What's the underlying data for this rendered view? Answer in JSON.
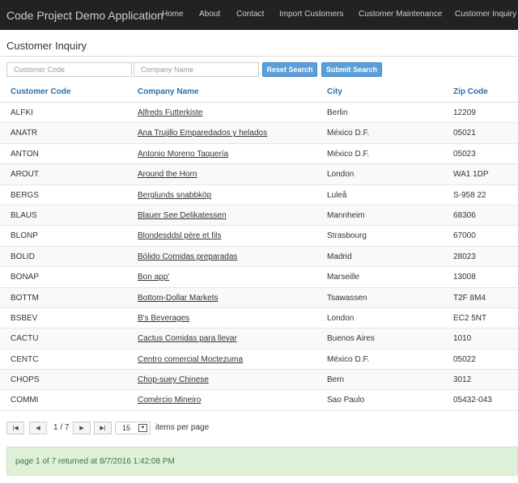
{
  "navbar": {
    "brand": "Code Project Demo Application",
    "links": [
      "Home",
      "About",
      "Contact",
      "Import Customers",
      "Customer Maintenance",
      "Customer Inquiry"
    ]
  },
  "page": {
    "title": "Customer Inquiry"
  },
  "search": {
    "customer_code_placeholder": "Customer Code",
    "company_name_placeholder": "Company Name",
    "reset_label": "Reset Search",
    "submit_label": "Submit Search"
  },
  "table": {
    "headers": [
      "Customer Code",
      "Company Name",
      "City",
      "Zip Code"
    ],
    "rows": [
      [
        "ALFKI",
        "Alfreds Futterkiste",
        "Berlin",
        "12209"
      ],
      [
        "ANATR",
        "Ana Trujillo Emparedados y helados",
        "México D.F.",
        "05021"
      ],
      [
        "ANTON",
        "Antonio Moreno Taquería",
        "México D.F.",
        "05023"
      ],
      [
        "AROUT",
        "Around the Horn",
        "London",
        "WA1 1DP"
      ],
      [
        "BERGS",
        "Berglunds snabbköp",
        "Luleå",
        "S-958 22"
      ],
      [
        "BLAUS",
        "Blauer See Delikatessen",
        "Mannheim",
        "68306"
      ],
      [
        "BLONP",
        "Blondesddsl père et fils",
        "Strasbourg",
        "67000"
      ],
      [
        "BOLID",
        "Bólido Comidas preparadas",
        "Madrid",
        "28023"
      ],
      [
        "BONAP",
        "Bon app'",
        "Marseille",
        "13008"
      ],
      [
        "BOTTM",
        "Bottom-Dollar Markets",
        "Tsawassen",
        "T2F 8M4"
      ],
      [
        "BSBEV",
        "B's Beverages",
        "London",
        "EC2 5NT"
      ],
      [
        "CACTU",
        "Cactus Comidas para llevar",
        "Buenos Aires",
        "1010"
      ],
      [
        "CENTC",
        "Centro comercial Moctezuma",
        "México D.F.",
        "05022"
      ],
      [
        "CHOPS",
        "Chop-suey Chinese",
        "Bern",
        "3012"
      ],
      [
        "COMMI",
        "Comércio Mineiro",
        "Sao Paulo",
        "05432-043"
      ]
    ]
  },
  "pager": {
    "first_icon": "first-page-icon",
    "prev_icon": "previous-page-icon",
    "next_icon": "next-page-icon",
    "last_icon": "last-page-icon",
    "page_info": "1 / 7",
    "page_size": "15",
    "items_per_page_label": "items per page"
  },
  "status": {
    "message": "page 1 of 7 returned at 8/7/2016 1:42:08 PM"
  },
  "colors": {
    "navbar_bg": "#222222",
    "header_link": "#2f6fa7",
    "button_primary": "#5b9ed8",
    "alert_bg": "#dff0d8",
    "alert_text": "#3c763d"
  }
}
